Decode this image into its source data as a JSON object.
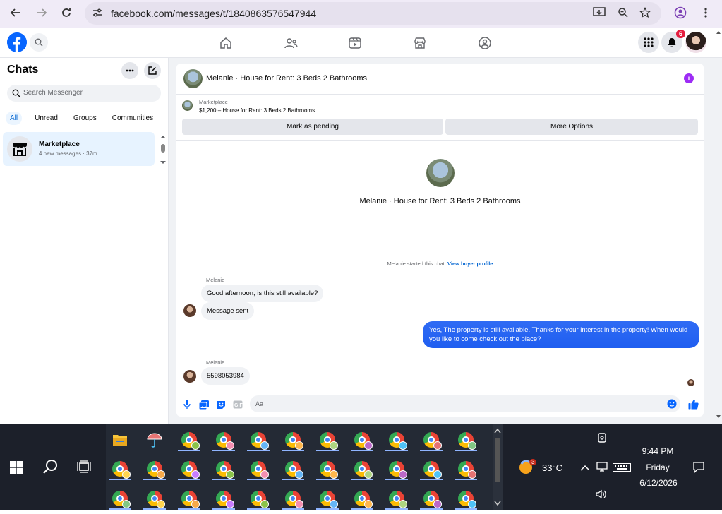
{
  "browser": {
    "url": "facebook.com/messages/t/1840863576547944"
  },
  "facebook": {
    "notifications_count": "6"
  },
  "sidebar": {
    "title": "Chats",
    "search_placeholder": "Search Messenger",
    "filters": [
      "All",
      "Unread",
      "Groups",
      "Communities"
    ],
    "conversation": {
      "name": "Marketplace",
      "subtitle": "4 new messages · 37m"
    }
  },
  "chat": {
    "header_title": "Melanie · House for Rent: 3 Beds 2 Bathrooms",
    "marketplace_label": "Marketplace",
    "listing": "$1,200 – House for Rent: 3 Beds 2 Bathrooms",
    "mark_pending": "Mark as pending",
    "more_options": "More Options",
    "center_title": "Melanie · House for Rent: 3 Beds 2 Bathrooms",
    "started_text": "Melanie started this chat.",
    "buyer_profile_link": "View buyer profile",
    "messages": {
      "sender1": "Melanie",
      "msg1": "Good afternoon, is this still available?",
      "msg2": "Message sent",
      "out1": "Yes, The property is still available. Thanks for your interest in the property! When would you like to come check out the place?",
      "sender2": "Melanie",
      "msg3": "5598053984"
    },
    "composer_placeholder": "Aa"
  },
  "taskbar": {
    "weather_badge": "3",
    "temperature": "33°C",
    "time": "9:44 PM",
    "day": "Friday",
    "date": "6/12/2026"
  },
  "colors": {
    "fb_blue": "#0866ff",
    "outgoing_bubble": "#2f6bf4",
    "taskbar": "#1f2430"
  }
}
